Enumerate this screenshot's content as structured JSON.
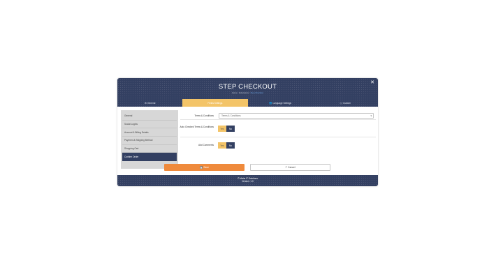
{
  "header": {
    "title": "STEP CHECKOUT",
    "breadcrumb": [
      "Home",
      "Extensions",
      "Step Checkout"
    ],
    "close_icon": "expand-arrows-icon"
  },
  "tabs": [
    {
      "label": "General",
      "icon": "gear-icon",
      "icon_glyph": "⚙",
      "active": false
    },
    {
      "label": "Fields Settings",
      "icon": "",
      "icon_glyph": "",
      "active": true
    },
    {
      "label": "Language Settings",
      "icon": "globe-icon",
      "icon_glyph": "🌐",
      "active": false
    },
    {
      "label": "Custom",
      "icon": "monitor-icon",
      "icon_glyph": "🖵",
      "active": false
    }
  ],
  "sidebar": {
    "items": [
      {
        "label": "General",
        "active": false
      },
      {
        "label": "Social Logins",
        "active": false
      },
      {
        "label": "Account & Billing Details",
        "active": false
      },
      {
        "label": "Payment & Shipping Method",
        "active": false
      },
      {
        "label": "Shopping Cart",
        "active": false
      },
      {
        "label": "Confirm Order",
        "active": true
      }
    ]
  },
  "form": {
    "terms": {
      "label": "Terms & Conditions",
      "value": "Terms & Conditions",
      "caret": "▾"
    },
    "auto_checked": {
      "label": "Auto Checked Terms & Conditions",
      "yes": "Yes",
      "no": "No"
    },
    "add_comments": {
      "label": "Add Comments",
      "yes": "Yes",
      "no": "No"
    }
  },
  "actions": {
    "save_label": "Save",
    "save_icon": "floppy-icon",
    "cancel_label": "Cancel",
    "cancel_icon": "undo-icon"
  },
  "footer": {
    "company": "© Mahe IT Solutions",
    "version": "Version: 1.0"
  },
  "colors": {
    "navy": "#334062",
    "accent_yellow": "#f3c468",
    "save_orange": "#ef8a3c"
  }
}
